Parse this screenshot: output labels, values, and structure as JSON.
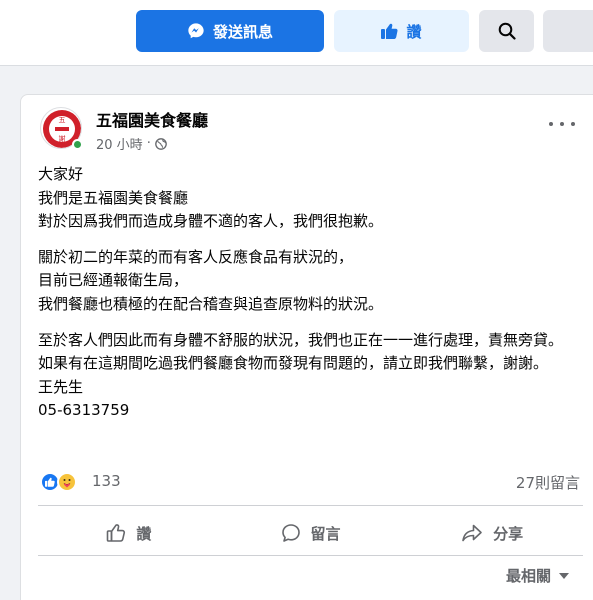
{
  "toolbar": {
    "message_label": "發送訊息",
    "like_label": "讚"
  },
  "post": {
    "page_name": "五福園美食餐廳",
    "avatar_text": "五福園",
    "time": "20 小時",
    "separator": "·",
    "paragraphs": [
      "大家好\n我們是五福園美食餐廳\n對於因爲我們而造成身體不適的客人，我們很抱歉。",
      "關於初二的年菜的而有客人反應食品有狀況的，\n目前已經通報衛生局，\n我們餐廳也積極的在配合稽查與追查原物料的狀況。",
      "至於客人們因此而有身體不舒服的狀況，我們也正在一一進行處理，責無旁貸。\n如果有在這期間吃過我們餐廳食物而發現有問題的，請立即我們聯繫，謝謝。\n王先生\n05-6313759"
    ],
    "reaction_count": "133",
    "comment_count": "27則留言"
  },
  "actions": {
    "like": "讚",
    "comment": "留言",
    "share": "分享"
  },
  "sort_label": "最相關",
  "colors": {
    "primary": "#1b74e4",
    "online": "#31a24c",
    "logo_red": "#d0202a"
  }
}
